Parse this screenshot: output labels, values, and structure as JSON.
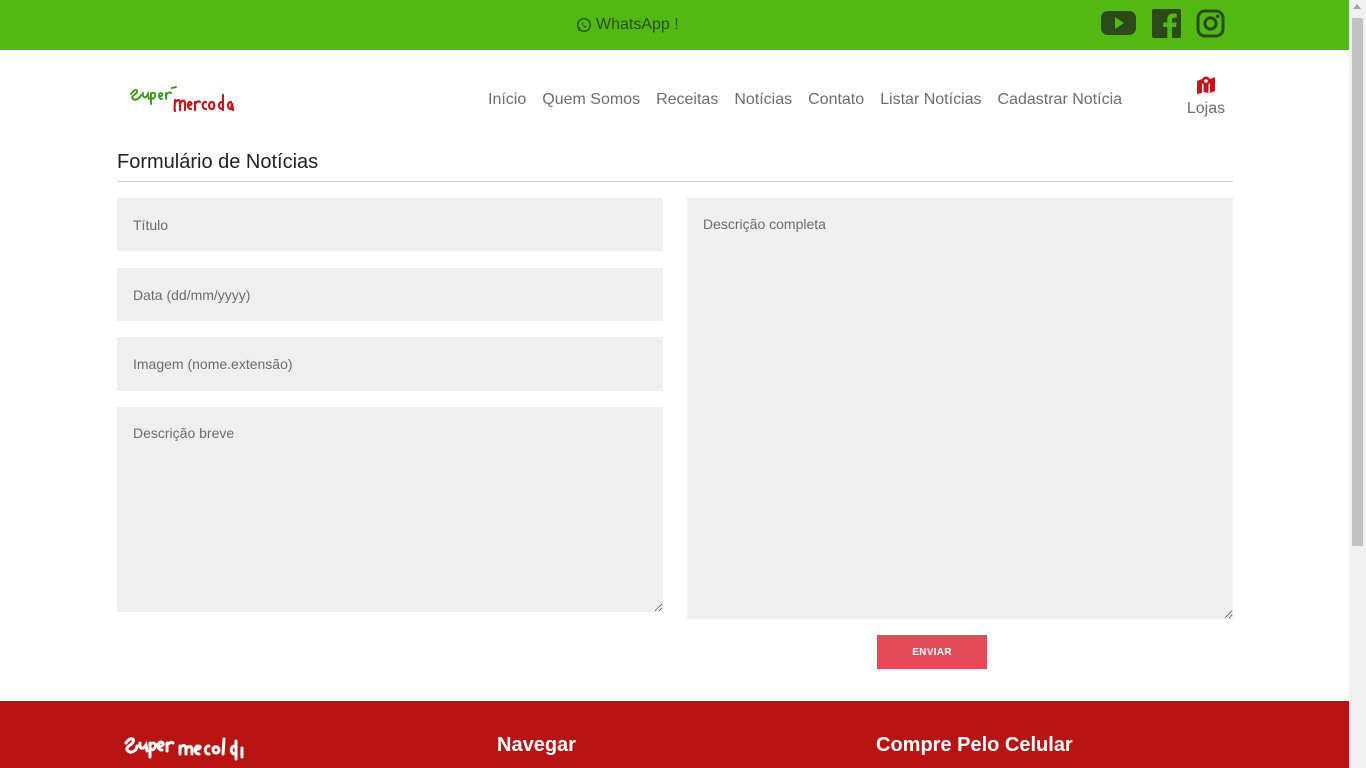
{
  "topbar": {
    "whatsapp_label": "WhatsApp !",
    "social_icons": [
      "youtube-icon",
      "facebook-icon",
      "instagram-icon"
    ]
  },
  "header": {
    "logo_alt": "Super Mercado",
    "nav": [
      "Início",
      "Quem Somos",
      "Receitas",
      "Notícias",
      "Contato",
      "Listar Notícias",
      "Cadastrar Notícia"
    ],
    "lojas_label": "Lojas"
  },
  "form": {
    "title": "Formulário de Notícias",
    "titulo_placeholder": "Título",
    "data_placeholder": "Data (dd/mm/yyyy)",
    "imagem_placeholder": "Imagem (nome.extensão)",
    "descricao_breve_placeholder": "Descrição breve",
    "descricao_completa_placeholder": "Descrição completa",
    "submit_label": "ENVIAR"
  },
  "footer": {
    "navegar_heading": "Navegar",
    "celular_heading": "Compre Pelo Celular"
  },
  "colors": {
    "topbar": "#52b813",
    "footer": "#b91414",
    "button": "#e44b58",
    "field_bg": "#efefef"
  }
}
